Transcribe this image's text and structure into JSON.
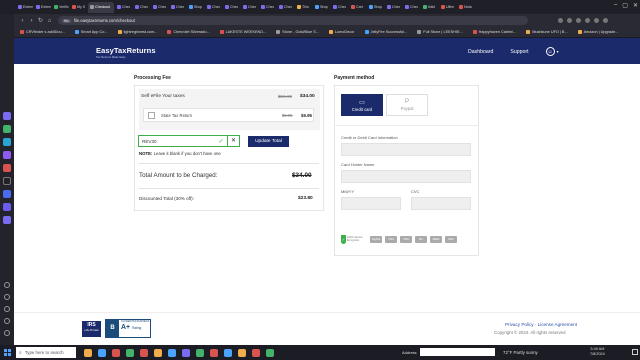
{
  "browser": {
    "tabs": [
      {
        "label": "Extensio",
        "color": "#7a6cf0"
      },
      {
        "label": "Extensio",
        "color": "#7a6cf0"
      },
      {
        "label": "Verific",
        "color": "#43b26b"
      },
      {
        "label": "My S",
        "color": "#d9534f"
      },
      {
        "label": "Checkout",
        "color": "#9a9a9a",
        "active": true
      },
      {
        "label": "Chec",
        "color": "#7a6cf0"
      },
      {
        "label": "Chec",
        "color": "#7a6cf0"
      },
      {
        "label": "Chec",
        "color": "#7a6cf0"
      },
      {
        "label": "Chec",
        "color": "#7a6cf0"
      },
      {
        "label": "Shop",
        "color": "#4aa3ff"
      },
      {
        "label": "Chec",
        "color": "#7a6cf0"
      },
      {
        "label": "Chec",
        "color": "#7a6cf0"
      },
      {
        "label": "Chec",
        "color": "#7a6cf0"
      },
      {
        "label": "Chec",
        "color": "#7a6cf0"
      },
      {
        "label": "Chec",
        "color": "#7a6cf0"
      },
      {
        "label": "This",
        "color": "#f0ad4e"
      },
      {
        "label": "Shop",
        "color": "#4aa3ff"
      },
      {
        "label": "Chec",
        "color": "#7a6cf0"
      },
      {
        "label": "Cart",
        "color": "#d9534f"
      },
      {
        "label": "Shop",
        "color": "#4aa3ff"
      },
      {
        "label": "Chec",
        "color": "#7a6cf0"
      },
      {
        "label": "Chec",
        "color": "#7a6cf0"
      },
      {
        "label": "Kábl",
        "color": "#43b26b"
      },
      {
        "label": "Ultim",
        "color": "#d9534f"
      },
      {
        "label": "Nota",
        "color": "#d9534f"
      }
    ],
    "url_prefix": "fttc",
    "url": "file.easytaxreturns.com/checkout",
    "bookmarks": [
      {
        "label": "CRVfinder s addiDou...",
        "color": "#d9534f"
      },
      {
        "label": "Smart App Co...",
        "color": "#4aa3ff"
      },
      {
        "label": "lightreginvest.com...",
        "color": "#f0ad4e"
      },
      {
        "label": "Chevrolet Silverado...",
        "color": "#d9534f"
      },
      {
        "label": "LAKESTE WEEKEND...",
        "color": "#d9534f"
      },
      {
        "label": "Stone - Gold/Blue S...",
        "color": "#999999"
      },
      {
        "label": "LumoDecor",
        "color": "#f0ad4e"
      },
      {
        "label": "JellyFire Successful...",
        "color": "#4aa3ff"
      },
      {
        "label": "Full Stone | LEESHIE...",
        "color": "#999999"
      },
      {
        "label": "Happyhaven Cabrini...",
        "color": "#d9534f"
      },
      {
        "label": "Mushkune UFO | B...",
        "color": "#f0ad4e"
      },
      {
        "label": "Amazon | Upgrade...",
        "color": "#f0ad4e"
      }
    ]
  },
  "site": {
    "logo": "EasyTaxReturns",
    "logo_sub": "Tax Returns Made Easy",
    "nav": {
      "dashboard": "Dashboard",
      "support": "Support"
    }
  },
  "fee": {
    "section_title": "Processing Fee",
    "main_item": "Self eFile Your taxes",
    "main_original": "$59.00",
    "main_price": "$34.00",
    "state_item": "State Tax Return",
    "state_original": "$9.95",
    "state_price": "$5.95",
    "promo_value": "REV30",
    "update_label": "Update Total",
    "note_bold": "NOTE:",
    "note_text": " Leave it blank if you don't have one",
    "total_label": "Total Amount to be Charged:",
    "total_original": "$34.00",
    "discount_label": "Discounted Total (30% off):",
    "discount_value": "$23.80"
  },
  "payment": {
    "section_title": "Payment method",
    "credit_card": "Credit card",
    "paypal": "Paypal",
    "card_number_label": "Credit or Debit Card Information",
    "holder_label": "Card Holder Name",
    "mmyy_label": "MM/YY",
    "cvc_label": "CVC",
    "secure_label": "100% Secure Encryption",
    "brands": [
      "PayPal",
      "VISA",
      "VISA",
      "MC",
      "AMEX",
      "DISC"
    ]
  },
  "footer": {
    "irs_top": "IRS",
    "irs_sub": "e-file Provider",
    "bbb_top": "ACCREDITED BUSINESS",
    "bbb_grade": "A+",
    "bbb_rating": "Rating",
    "links": "Privacy Policy · License Agreement",
    "copyright": "Copyright © 2024. All rights reserved"
  },
  "taskbar": {
    "search_placeholder": "Type here to search",
    "address_label": "Address",
    "weather": "72°F  Partly sunny",
    "time": "3:49 AM",
    "date": "7/8/2024",
    "apps": [
      "#f0ad4e",
      "#4aa3ff",
      "#d9534f",
      "#43b26b",
      "#d9534f",
      "#f0ad4e",
      "#4aa3ff",
      "#7a6cf0",
      "#43b26b",
      "#d9534f",
      "#4aa3ff",
      "#f0ad4e",
      "#d9534f",
      "#43b26b"
    ]
  }
}
